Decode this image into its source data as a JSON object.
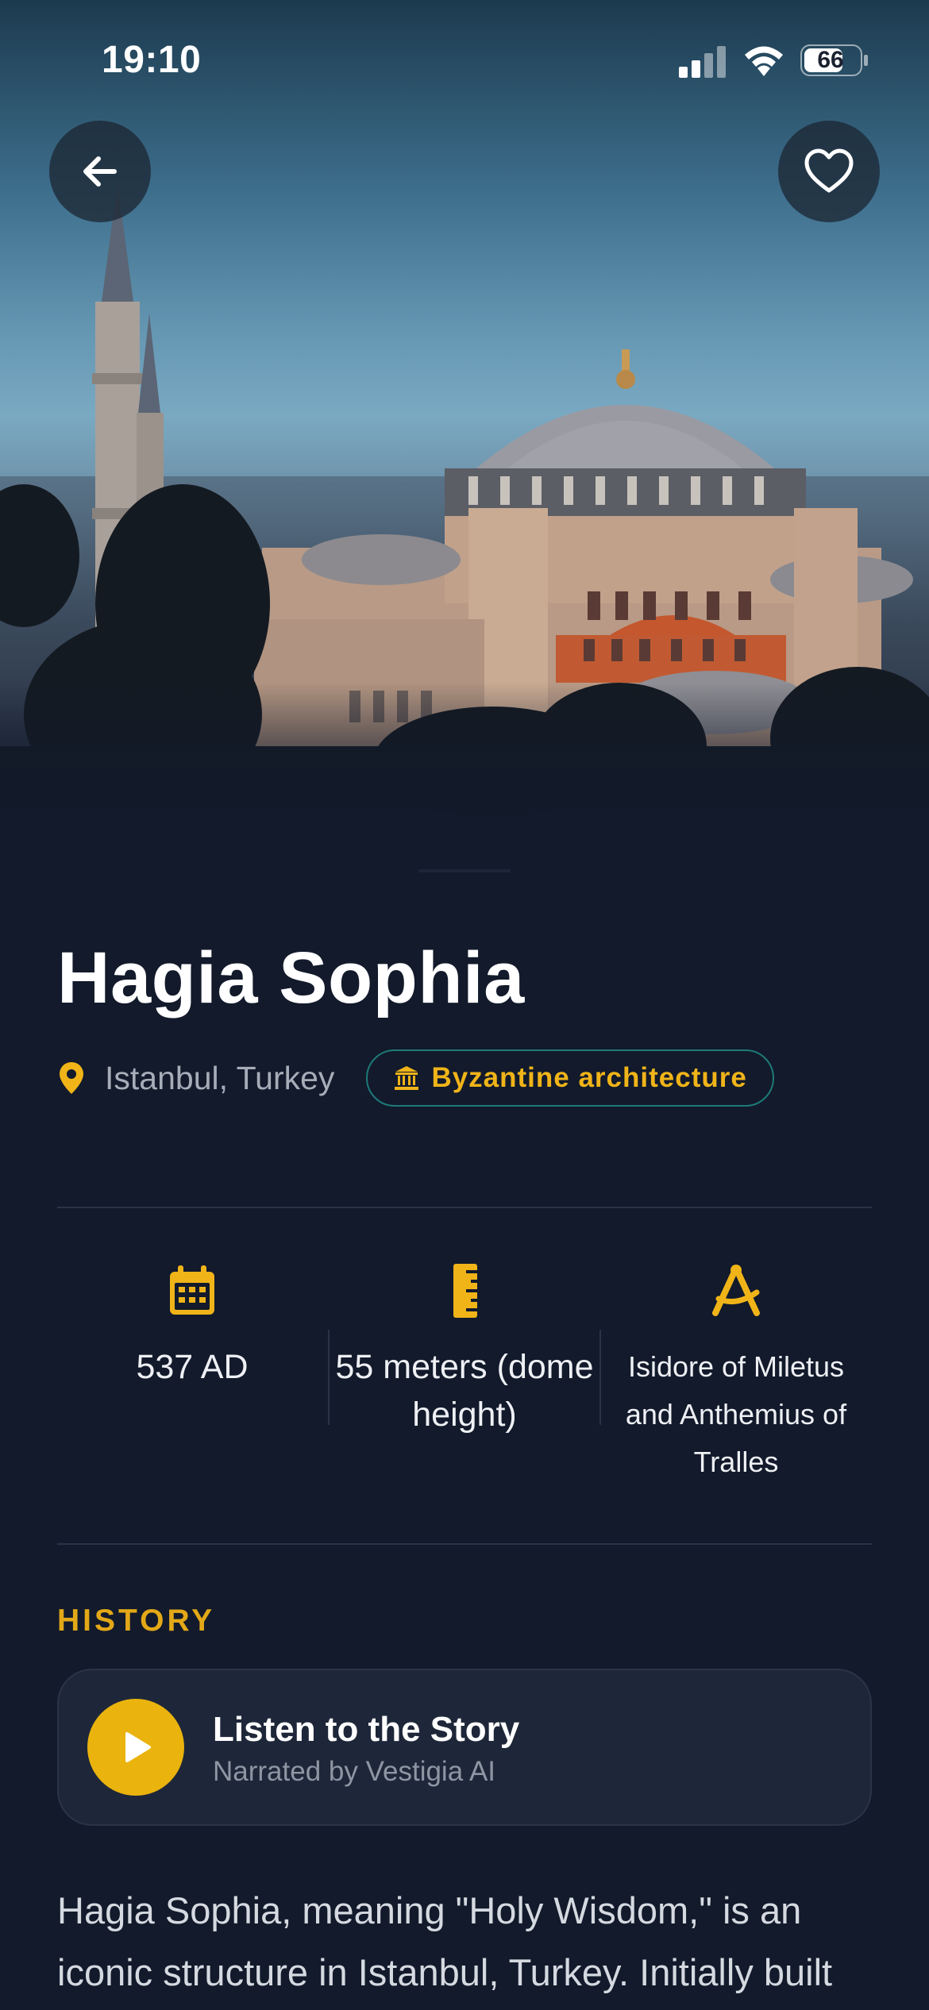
{
  "status_bar": {
    "time": "19:10",
    "battery": "66",
    "icons": [
      "signal-icon",
      "wifi-icon",
      "battery-icon"
    ]
  },
  "header": {
    "back_icon": "arrow-left-icon",
    "favorite_icon": "heart-icon"
  },
  "landmark": {
    "name": "Hagia Sophia",
    "location": "Istanbul, Turkey",
    "style_tag": "Byzantine architecture"
  },
  "stats": [
    {
      "icon": "calendar-icon",
      "value": "537 AD"
    },
    {
      "icon": "ruler-icon",
      "value": "55 meters (dome height)"
    },
    {
      "icon": "compass-icon",
      "value": "Isidore of Miletus and Anthemius of Tralles"
    }
  ],
  "history": {
    "section_label": "HISTORY",
    "audio_title": "Listen to the Story",
    "audio_subtitle": "Narrated by Vestigia AI",
    "body": "Hagia Sophia, meaning \"Holy Wisdom,\" is an iconic structure in Istanbul, Turkey. Initially built"
  },
  "colors": {
    "background": "#121a2b",
    "accent": "#f0b419",
    "tag_border": "#1e7a78",
    "card": "#1e2739"
  }
}
